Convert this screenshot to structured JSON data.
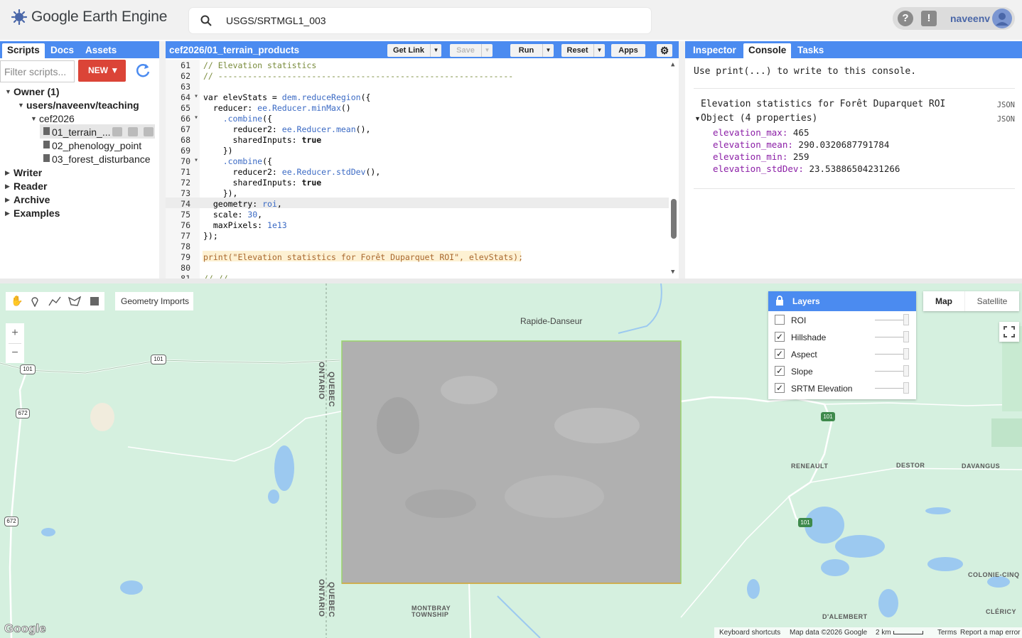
{
  "app": {
    "title": "Google Earth Engine"
  },
  "search": {
    "value": "USGS/SRTMGL1_003"
  },
  "user": {
    "help": "?",
    "feedback": "!",
    "name": "naveenv"
  },
  "left_panel": {
    "tabs": [
      "Scripts",
      "Docs",
      "Assets"
    ],
    "filter_placeholder": "Filter scripts...",
    "new_label": "NEW",
    "tree": {
      "owner": "Owner (1)",
      "repo": "users/naveenv/teaching",
      "folder": "cef2026",
      "files": [
        "01_terrain_...",
        "02_phenology_point",
        "03_forest_disturbance"
      ],
      "groups": [
        "Writer",
        "Reader",
        "Archive",
        "Examples"
      ]
    }
  },
  "editor": {
    "path": "cef2026/01_terrain_products",
    "buttons": {
      "get_link": "Get Link",
      "save": "Save",
      "run": "Run",
      "reset": "Reset",
      "apps": "Apps"
    },
    "line_numbers": [
      "61",
      "62",
      "63",
      "64",
      "65",
      "66",
      "67",
      "68",
      "69",
      "70",
      "71",
      "72",
      "73",
      "74",
      "75",
      "76",
      "77",
      "78",
      "79",
      "80",
      "81"
    ],
    "lines": [
      "// Elevation statistics",
      "// ------------------------------------------------------------",
      "",
      "var elevStats = dem.reduceRegion({",
      "  reducer: ee.Reducer.minMax()",
      "    .combine({",
      "      reducer2: ee.Reducer.mean(),",
      "      sharedInputs: true",
      "    })",
      "    .combine({",
      "      reducer2: ee.Reducer.stdDev(),",
      "      sharedInputs: true",
      "    }),",
      "  geometry: roi,",
      "  scale: 30,",
      "  maxPixels: 1e13",
      "});",
      "",
      "print(\"Elevation statistics for Forêt Duparquet ROI\", elevStats);",
      "",
      "// // ------------------------------------------------------------"
    ]
  },
  "right_panel": {
    "tabs": [
      "Inspector",
      "Console",
      "Tasks"
    ],
    "hint": "Use print(...) to write to this console.",
    "output_title": "Elevation statistics for Forêt Duparquet ROI",
    "json_tag": "JSON",
    "object_label": "Object (4 properties)",
    "props": [
      {
        "key": "elevation_max:",
        "value": "465"
      },
      {
        "key": "elevation_mean:",
        "value": "290.0320687791784"
      },
      {
        "key": "elevation_min:",
        "value": "259"
      },
      {
        "key": "elevation_stdDev:",
        "value": "23.53886504231266"
      }
    ]
  },
  "map": {
    "geometry_imports": "Geometry Imports",
    "zoom_in": "+",
    "zoom_out": "−",
    "layers_title": "Layers",
    "layers": [
      {
        "name": "ROI",
        "checked": false
      },
      {
        "name": "Hillshade",
        "checked": true
      },
      {
        "name": "Aspect",
        "checked": true
      },
      {
        "name": "Slope",
        "checked": true
      },
      {
        "name": "SRTM Elevation",
        "checked": true
      }
    ],
    "map_type": {
      "map": "Map",
      "satellite": "Satellite"
    },
    "labels": {
      "rapide": "Rapide-Danseur",
      "quebec": "QUEBEC",
      "ontario": "ONTARIO",
      "renault": "RENEAULT",
      "destor": "DESTOR",
      "davangus": "DAVANGUS",
      "colonie": "COLONIE-CINQ",
      "clericy": "CLÉRICY",
      "dalembert": "D'ALEMBERT",
      "montbray": "MONTBRAY",
      "township": "TOWNSHIP",
      "r101": "101",
      "r672": "672"
    },
    "attribution": {
      "keyboard": "Keyboard shortcuts",
      "data": "Map data ©2026 Google",
      "scale": "2 km",
      "terms": "Terms",
      "report": "Report a map error"
    },
    "google_logo": "Google"
  },
  "colors": {
    "accent": "#4b8bf0",
    "new_button": "#db4437",
    "land": "#d5f0df",
    "water": "#9cc9f0"
  }
}
